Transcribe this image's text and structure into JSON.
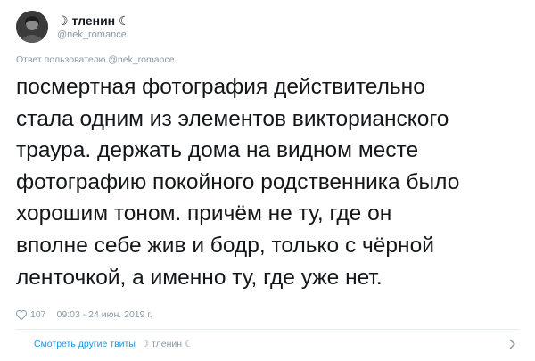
{
  "author": {
    "display_name": "☽ тленин ☾",
    "handle": "@nek_romance"
  },
  "reply_to": "Ответ пользователю @nek_romance",
  "text_lines": [
    "посмертная фотография действительно",
    "стала одним из элементов викторианского",
    "траура. держать дома на видном месте",
    "фотографию покойного родственника было",
    "хорошим тоном. причём не ту, где он",
    "вполне себе жив и бодр, только с чёрной",
    "ленточкой, а именно ту, где уже нет."
  ],
  "meta": {
    "likes": "107",
    "timestamp": "09:03 - 24 июн. 2019 г."
  },
  "more_link": {
    "label": "Смотреть другие твиты",
    "handle": "☽ тленин ☾"
  },
  "icons": {
    "like": "heart-icon",
    "more": "chevron-right-icon"
  },
  "colors": {
    "text": "#14171a",
    "muted": "#8899a6",
    "link": "#1b95e0"
  }
}
